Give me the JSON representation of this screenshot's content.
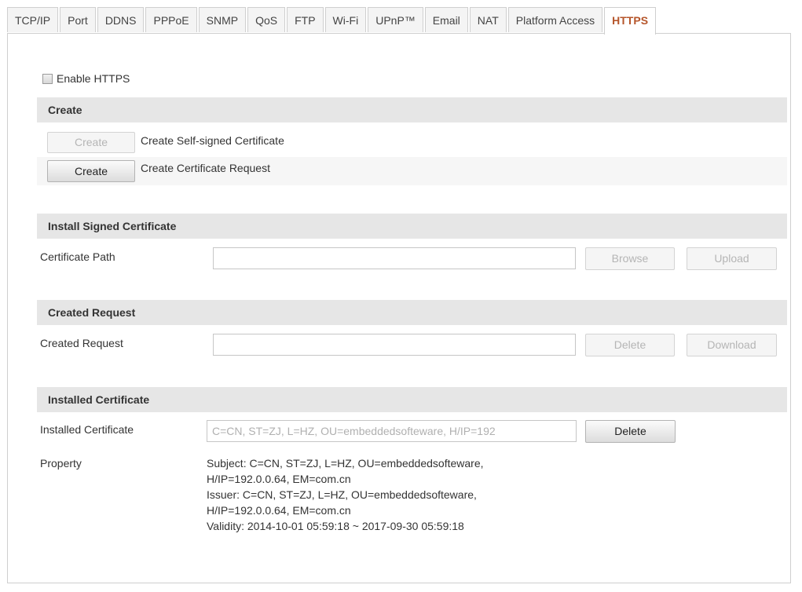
{
  "tabs": [
    {
      "label": "TCP/IP",
      "active": false
    },
    {
      "label": "Port",
      "active": false
    },
    {
      "label": "DDNS",
      "active": false
    },
    {
      "label": "PPPoE",
      "active": false
    },
    {
      "label": "SNMP",
      "active": false
    },
    {
      "label": "QoS",
      "active": false
    },
    {
      "label": "FTP",
      "active": false
    },
    {
      "label": "Wi-Fi",
      "active": false
    },
    {
      "label": "UPnP™",
      "active": false
    },
    {
      "label": "Email",
      "active": false
    },
    {
      "label": "NAT",
      "active": false
    },
    {
      "label": "Platform Access",
      "active": false
    },
    {
      "label": "HTTPS",
      "active": true
    }
  ],
  "enable_https": {
    "label": "Enable  HTTPS",
    "checked": false
  },
  "create": {
    "title": "Create",
    "self_signed": {
      "button": "Create",
      "desc": "Create Self-signed Certificate",
      "enabled": false
    },
    "request": {
      "button": "Create",
      "desc": "Create Certificate Request",
      "enabled": true
    }
  },
  "install": {
    "title": "Install Signed Certificate",
    "path_label": "Certificate Path",
    "path_value": "",
    "browse": "Browse",
    "upload": "Upload"
  },
  "created_request": {
    "title": "Created Request",
    "label": "Created Request",
    "value": "",
    "delete": "Delete",
    "download": "Download"
  },
  "installed": {
    "title": "Installed Certificate",
    "label": "Installed Certificate",
    "value": "C=CN, ST=ZJ, L=HZ, OU=embeddedsofteware, H/IP=192",
    "delete": "Delete",
    "property_label": "Property",
    "property_lines": [
      "Subject: C=CN, ST=ZJ, L=HZ, OU=embeddedsofteware,",
      "H/IP=192.0.0.64, EM=com.cn",
      "Issuer: C=CN, ST=ZJ, L=HZ, OU=embeddedsofteware,",
      "H/IP=192.0.0.64, EM=com.cn",
      "Validity: 2014-10-01 05:59:18 ~ 2017-09-30 05:59:18"
    ]
  },
  "colors": {
    "active_tab": "#b5552a",
    "section_bg": "#e6e6e6"
  }
}
